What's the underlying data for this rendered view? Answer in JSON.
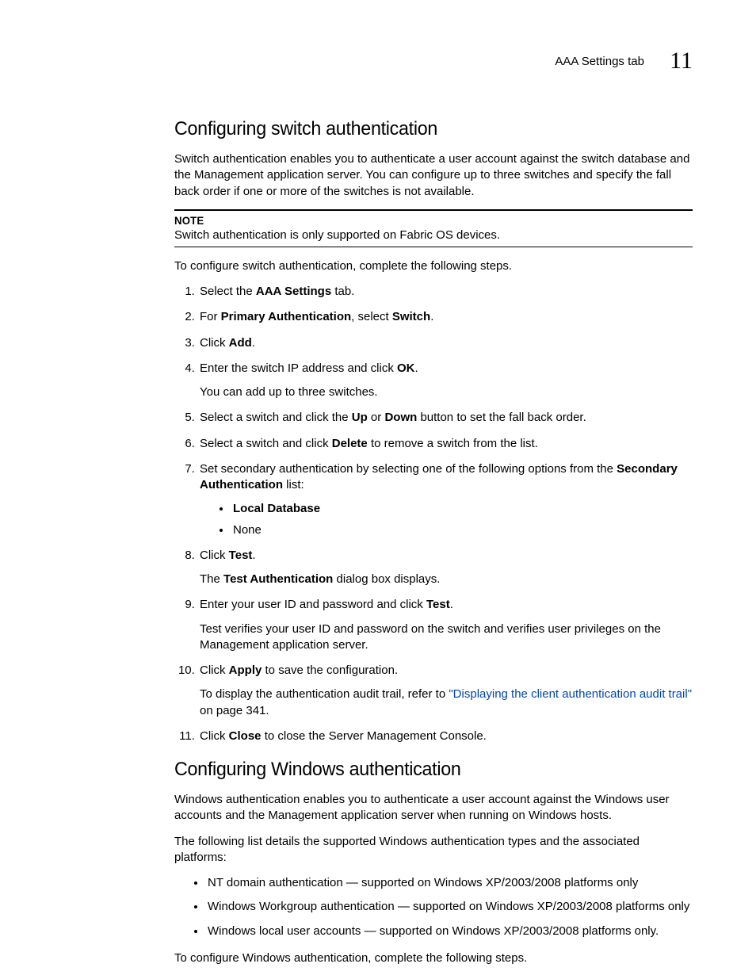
{
  "header": {
    "tab_label": "AAA Settings tab",
    "chapter_number": "11"
  },
  "section1": {
    "title": "Configuring switch authentication",
    "intro": "Switch authentication enables you to authenticate a user account against the switch database and the Management application server. You can configure up to three switches and specify the fall back order if one or more of the switches is not available.",
    "note_label": "NOTE",
    "note_text": "Switch authentication is only supported on Fabric OS devices.",
    "lead_in": "To configure switch authentication, complete the following steps.",
    "steps": {
      "s1_a": "Select the ",
      "s1_b": "AAA Settings",
      "s1_c": " tab.",
      "s2_a": "For ",
      "s2_b": "Primary Authentication",
      "s2_c": ", select ",
      "s2_d": "Switch",
      "s2_e": ".",
      "s3_a": "Click ",
      "s3_b": "Add",
      "s3_c": ".",
      "s4_a": "Enter the switch IP address and click ",
      "s4_b": "OK",
      "s4_c": ".",
      "s4_sub": "You can add up to three switches.",
      "s5_a": "Select a switch and click the ",
      "s5_b": "Up",
      "s5_c": " or ",
      "s5_d": "Down",
      "s5_e": " button to set the fall back order.",
      "s6_a": "Select a switch and click ",
      "s6_b": "Delete",
      "s6_c": " to remove a switch from the list.",
      "s7_a": "Set secondary authentication by selecting one of the following options from the ",
      "s7_b": "Secondary Authentication",
      "s7_c": " list:",
      "s7_opt1": "Local Database",
      "s7_opt2": "None",
      "s8_a": "Click ",
      "s8_b": "Test",
      "s8_c": ".",
      "s8_sub_a": "The ",
      "s8_sub_b": "Test Authentication",
      "s8_sub_c": " dialog box displays.",
      "s9_a": "Enter your user ID and password and click ",
      "s9_b": "Test",
      "s9_c": ".",
      "s9_sub": "Test verifies your user ID and password on the switch and verifies user privileges on the Management application server.",
      "s10_a": "Click ",
      "s10_b": "Apply",
      "s10_c": " to save the configuration.",
      "s10_sub_a": "To display the authentication audit trail, refer to ",
      "s10_link": "\"Displaying the client authentication audit trail\"",
      "s10_sub_b": " on page 341.",
      "s11_a": "Click ",
      "s11_b": "Close",
      "s11_c": " to close the Server Management Console."
    }
  },
  "section2": {
    "title": "Configuring Windows authentication",
    "p1": "Windows authentication enables you to authenticate a user account against the Windows user accounts and the Management application server when running on Windows hosts.",
    "p2": "The following list details the supported Windows authentication types and the associated platforms:",
    "bullets": {
      "b1": "NT domain authentication — supported on Windows XP/2003/2008 platforms only",
      "b2": "Windows Workgroup authentication — supported on Windows XP/2003/2008 platforms only",
      "b3": "Windows local user accounts — supported on Windows XP/2003/2008 platforms only."
    },
    "lead_in": "To configure Windows authentication, complete the following steps."
  }
}
